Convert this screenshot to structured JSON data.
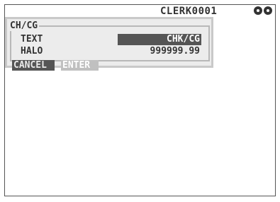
{
  "header": {
    "clerk": "CLERK0001",
    "keys": [
      "key-icon",
      "key-icon"
    ]
  },
  "dialog": {
    "title": "CH/CG",
    "rows": [
      {
        "label": "TEXT",
        "value": "CHK/CG"
      },
      {
        "label": "HALO",
        "value": "999999.99"
      }
    ],
    "buttons": {
      "cancel": "CANCEL",
      "enter": "ENTER"
    }
  },
  "colors": {
    "dark": "#555555",
    "dialog_bg": "#ececec",
    "frame": "#c9c9c9"
  }
}
